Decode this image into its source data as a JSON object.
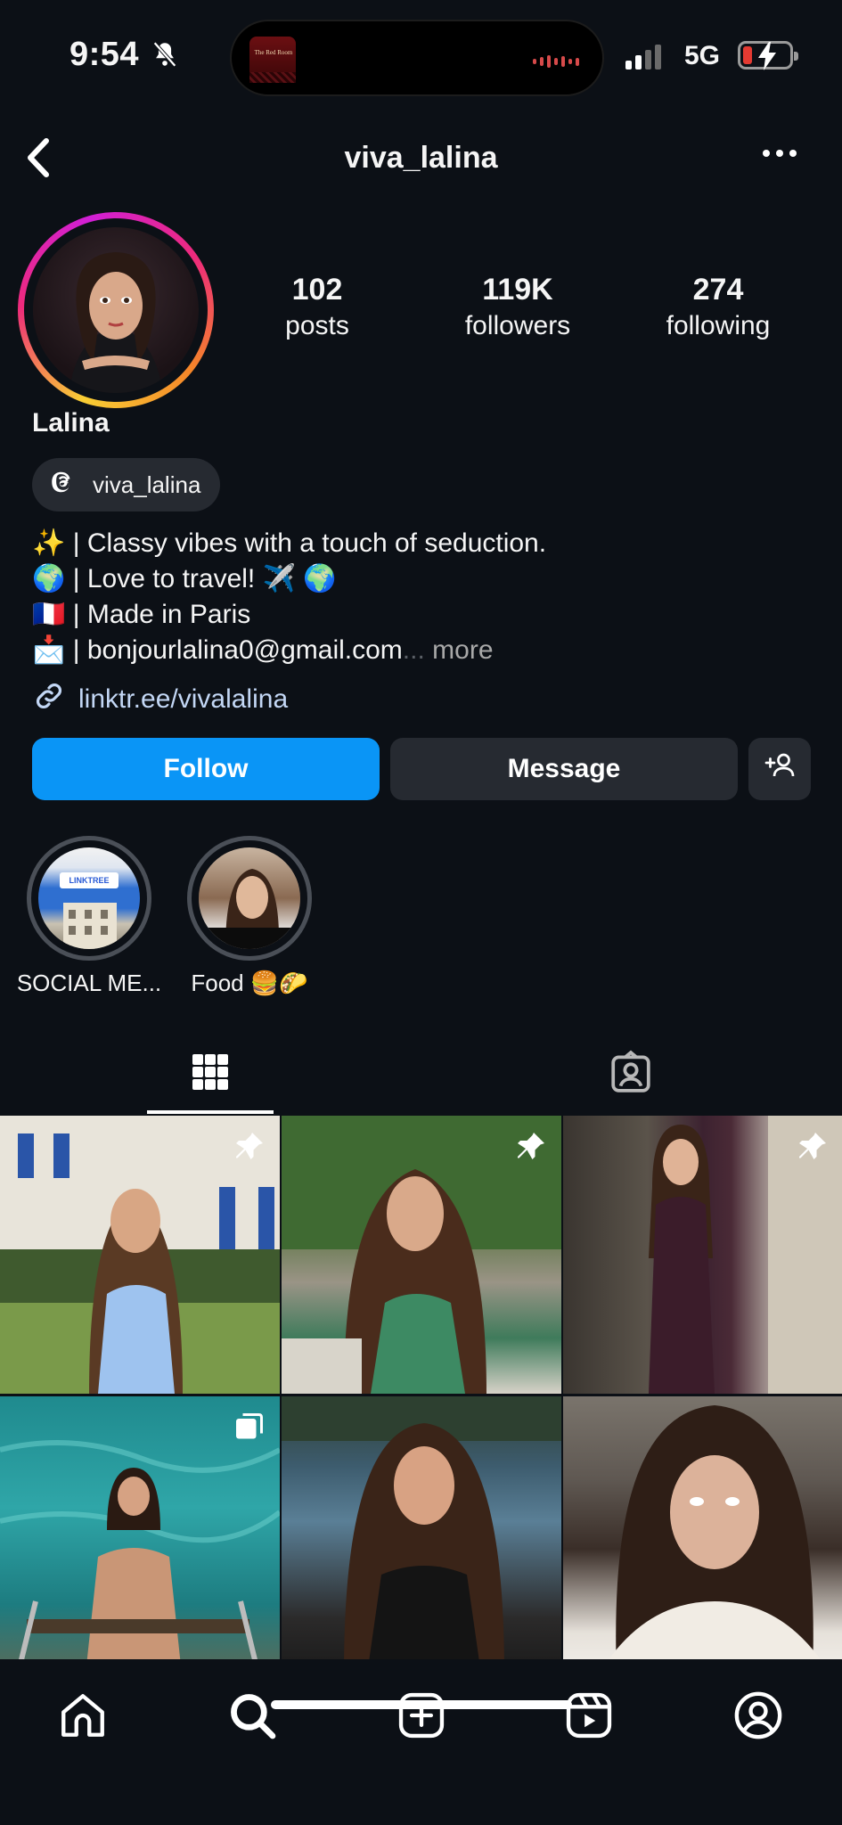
{
  "status_bar": {
    "time": "9:54",
    "network": "5G",
    "island_media_title": "The Red Room",
    "battery_level": 0.15,
    "icons": [
      "bell-slash-icon",
      "signal-icon",
      "battery-charging-icon"
    ]
  },
  "header": {
    "username": "viva_lalina",
    "icons": [
      "back-chevron-icon",
      "more-dots-icon"
    ]
  },
  "profile": {
    "display_name": "Lalina",
    "stats": [
      {
        "num": "102",
        "label": "posts"
      },
      {
        "num": "119K",
        "label": "followers"
      },
      {
        "num": "274",
        "label": "following"
      }
    ],
    "threads_handle": "viva_lalina",
    "bio": [
      {
        "emoji": "✨",
        "text": " | Classy vibes with a touch of seduction."
      },
      {
        "emoji": "🌍",
        "text": " | Love to travel! ✈️ 🌍"
      },
      {
        "emoji": "🇫🇷",
        "text": " | Made in Paris"
      },
      {
        "emoji": "📩",
        "text": " | bonjourlalina0@gmail.com",
        "ellipsis": "...",
        "more": " more"
      }
    ],
    "link": "linktr.ee/vivalalina"
  },
  "actions": {
    "follow": "Follow",
    "message": "Message"
  },
  "highlights": [
    {
      "label": "SOCIAL ME...",
      "cover_text": "LINKTREE"
    },
    {
      "label": "Food 🍔🌮"
    }
  ],
  "tabs": [
    "grid-icon",
    "tagged-icon"
  ],
  "posts": [
    {
      "badge": "pin-icon"
    },
    {
      "badge": "pin-icon"
    },
    {
      "badge": "pin-icon"
    },
    {
      "badge": "carousel-icon"
    },
    {
      "badge": ""
    },
    {
      "badge": ""
    }
  ],
  "bottom_nav": [
    "home-icon",
    "search-icon",
    "create-icon",
    "reels-icon",
    "profile-icon"
  ],
  "colors": {
    "background": "#0c1016",
    "follow_button": "#0a95f6",
    "secondary_button": "#262a31",
    "link": "#c3d7f5"
  }
}
